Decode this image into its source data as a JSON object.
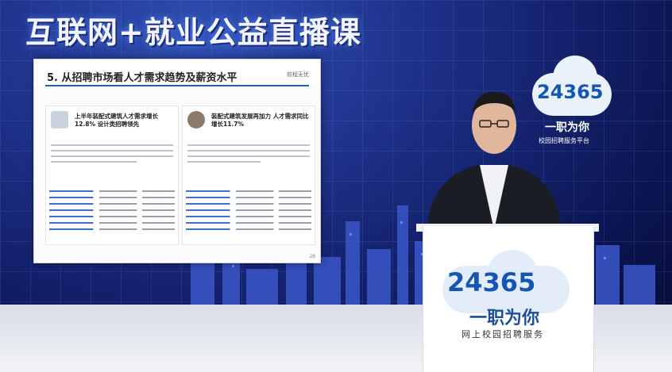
{
  "banner": {
    "title": "互联网+就业公益直播课"
  },
  "slide": {
    "heading": "5. 从招聘市场看人才需求趋势及薪资水平",
    "logo": "前程无忧",
    "card_left": {
      "headline": "上半年装配式建筑人才需求增长12.8% 设计类招聘领先"
    },
    "card_right": {
      "headline": "装配式建筑发展再加力 人才需求同比增长11.7%"
    },
    "page_number": "28"
  },
  "brand_logo": {
    "number": "24365",
    "slogan": "一职为你",
    "subtitle": "校园招聘服务平台"
  },
  "podium_logo": {
    "number": "24365",
    "slogan": "一职为你",
    "subtitle": "网上校园招聘服务"
  }
}
